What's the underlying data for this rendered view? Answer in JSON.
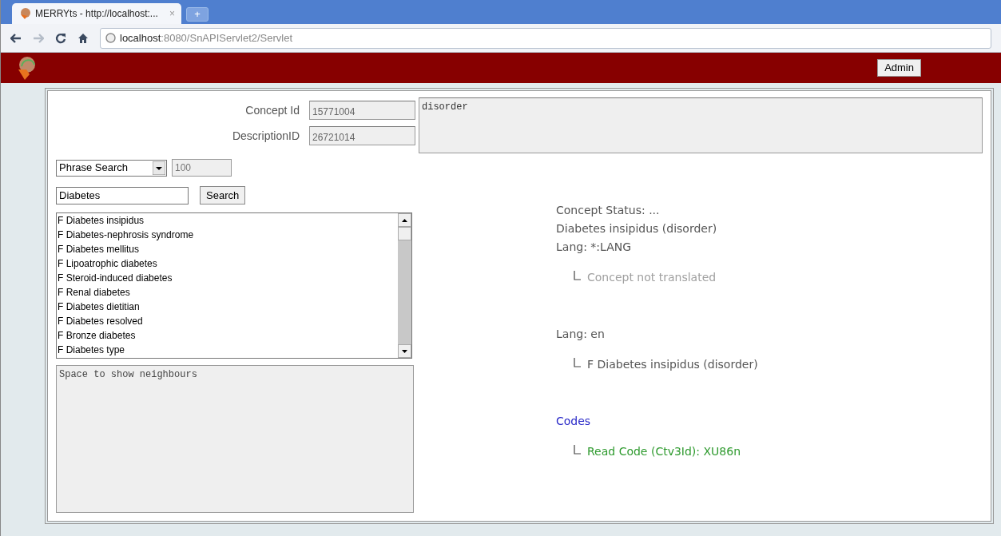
{
  "browser": {
    "tab_title": "MERRYts - http://localhost:...",
    "tab_close": "×",
    "new_tab": "+",
    "url_host": "localhost",
    "url_path": ":8080/SnAPIServlet2/Servlet"
  },
  "header": {
    "admin_button": "Admin"
  },
  "concept_id": {
    "label": "Concept Id",
    "value": "15771004"
  },
  "description_id": {
    "label": "DescriptionID",
    "value": "26721014"
  },
  "semantic_tag": "disorder",
  "search_mode": {
    "value": "Phrase Search",
    "limit": "100"
  },
  "search": {
    "value": "Diabetes",
    "button": "Search"
  },
  "results": [
    {
      "text": "F Diabetes insipidus",
      "selected": false
    },
    {
      "text": "F Diabetes-nephrosis syndrome",
      "selected": false
    },
    {
      "text": "F Diabetes mellitus",
      "selected": false
    },
    {
      "text": "F Lipoatrophic diabetes",
      "selected": false
    },
    {
      "text": "F Steroid-induced diabetes",
      "selected": false
    },
    {
      "text": "F Renal diabetes",
      "selected": false
    },
    {
      "text": "F Diabetes dietitian",
      "selected": false
    },
    {
      "text": "F Diabetes resolved",
      "selected": false
    },
    {
      "text": "F Bronze diabetes",
      "selected": false
    },
    {
      "text": "F Diabetes type",
      "selected": false
    }
  ],
  "neighbours": "Space to show neighbours",
  "details": {
    "status": "Concept Status: ...",
    "term": "Diabetes insipidus (disorder)",
    "sections": [
      {
        "heading": "Lang: *:LANG",
        "kind": "plain",
        "children": [
          {
            "text": "Concept not translated",
            "kind": "note"
          }
        ]
      },
      {
        "heading": "Lang: en",
        "kind": "plain",
        "children": [
          {
            "text": "F Diabetes insipidus (disorder)",
            "kind": "term"
          }
        ]
      },
      {
        "heading": "Codes",
        "kind": "link",
        "children": [
          {
            "text": "Read Code (Ctv3Id): XU86n",
            "kind": "code"
          }
        ]
      }
    ]
  }
}
